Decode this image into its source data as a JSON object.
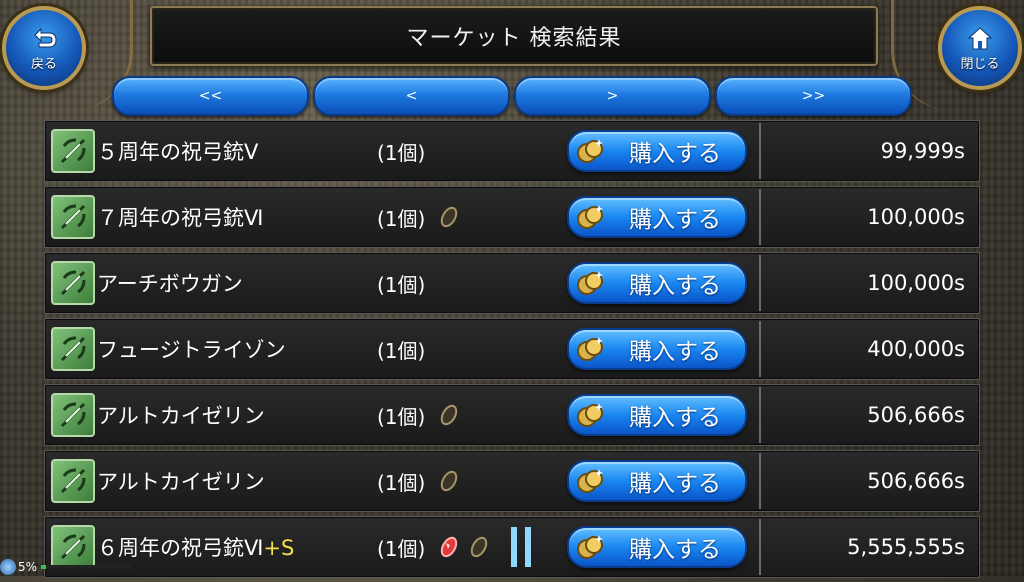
{
  "header": {
    "title": "マーケット 検索結果"
  },
  "nav": {
    "back_label": "戻る",
    "close_label": "閉じる"
  },
  "pager": [
    "<<",
    "<",
    ">",
    ">>"
  ],
  "buy_label": "購入する",
  "rows": [
    {
      "name": "５周年の祝弓銃Ⅴ",
      "qty": "(1個)",
      "price": "99,999s"
    },
    {
      "name": "７周年の祝弓銃Ⅵ",
      "qty": "(1個)",
      "price": "100,000s"
    },
    {
      "name": "アーチボウガン",
      "qty": "(1個)",
      "price": "100,000s"
    },
    {
      "name": "フュージトライゾン",
      "qty": "(1個)",
      "price": "400,000s"
    },
    {
      "name": "アルトカイゼリン",
      "qty": "(1個)",
      "price": "506,666s"
    },
    {
      "name": "アルトカイゼリン",
      "qty": "(1個)",
      "price": "506,666s"
    },
    {
      "name": "６周年の祝弓銃Ⅵ",
      "plus": "+S",
      "qty": "(1個)",
      "price": "5,555,555s"
    }
  ],
  "status": {
    "percent": "5%",
    "level": 0.05
  },
  "icons": {
    "item": "crossbow-icon",
    "seed": "seed-slot-icon",
    "gem": "red-gem-icon",
    "coin": "coin-icon",
    "back": "return-arrow-icon",
    "close": "home-icon"
  },
  "colors": {
    "accent": "#1a86f0",
    "plus": "#f2e14a",
    "frame": "#8c7a52"
  }
}
